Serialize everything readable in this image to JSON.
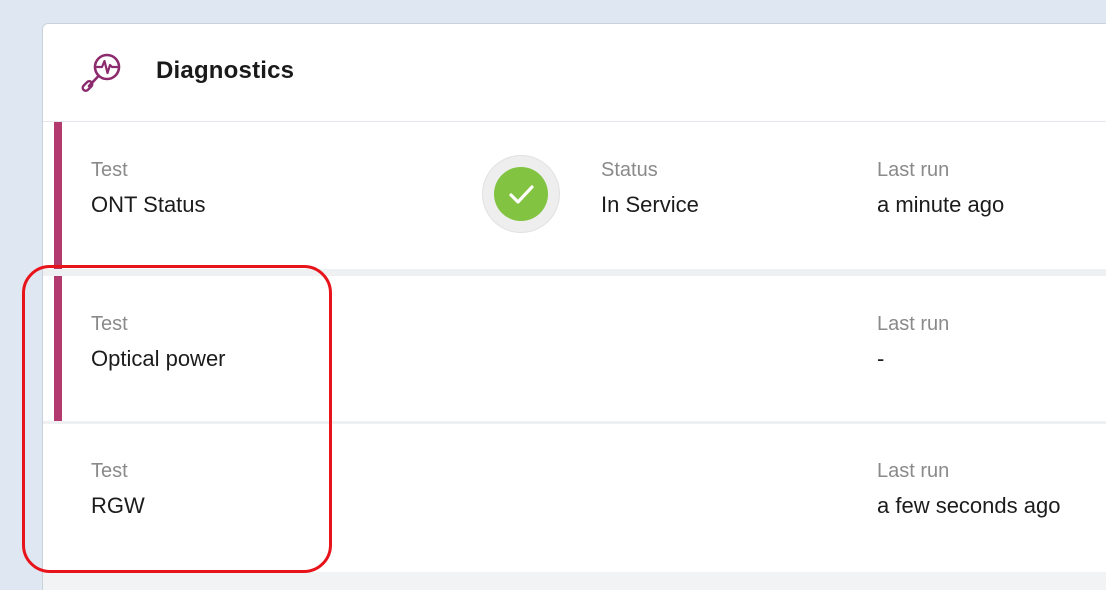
{
  "panel": {
    "title": "Diagnostics",
    "icon": "diagnostics-magnifier-icon",
    "accent_color": "#b23a6e",
    "icon_color": "#8b2a6d"
  },
  "tests": [
    {
      "test_label": "Test",
      "test_name": "ONT Status",
      "status_label": "Status",
      "status_value": "In Service",
      "status_icon": "check-circle-icon",
      "status_color": "#82c341",
      "last_run_label": "Last run",
      "last_run_value": "a minute ago"
    },
    {
      "test_label": "Test",
      "test_name": "Optical power",
      "last_run_label": "Last run",
      "last_run_value": "-"
    },
    {
      "test_label": "Test",
      "test_name": "RGW",
      "last_run_label": "Last run",
      "last_run_value": "a few seconds ago"
    }
  ],
  "annotation": {
    "highlight_color": "#e8141c"
  }
}
